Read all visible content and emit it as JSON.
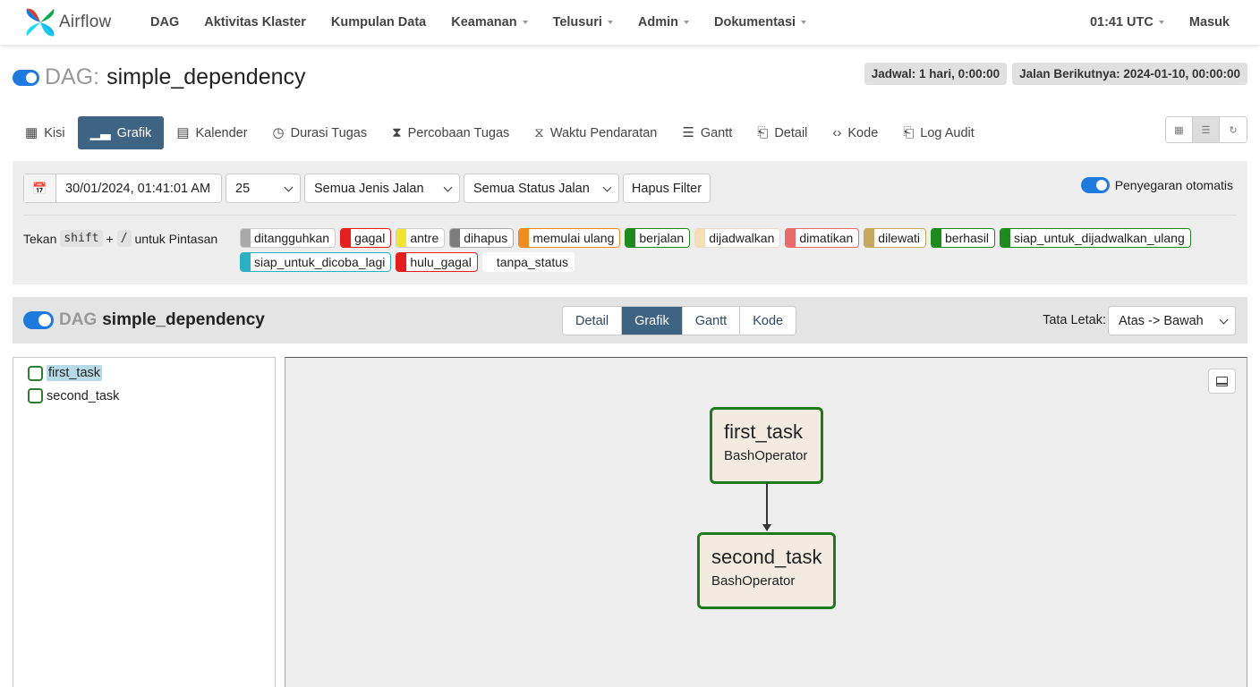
{
  "navbar": {
    "brand": "Airflow",
    "items": [
      {
        "label": "DAG",
        "dropdown": false
      },
      {
        "label": "Aktivitas Klaster",
        "dropdown": false
      },
      {
        "label": "Kumpulan Data",
        "dropdown": false
      },
      {
        "label": "Keamanan",
        "dropdown": true
      },
      {
        "label": "Telusuri",
        "dropdown": true
      },
      {
        "label": "Admin",
        "dropdown": true
      },
      {
        "label": "Dokumentasi",
        "dropdown": true
      }
    ],
    "time": "01:41 UTC",
    "login": "Masuk"
  },
  "dag": {
    "label": "DAG:",
    "name": "simple_dependency",
    "schedule_badge": "Jadwal: 1 hari, 0:00:00",
    "next_run_badge": "Jalan Berikutnya: 2024-01-10, 00:00:00"
  },
  "tabs": [
    {
      "label": "Kisi",
      "icon": "grid-icon"
    },
    {
      "label": "Grafik",
      "icon": "bar-chart-icon",
      "active": true
    },
    {
      "label": "Kalender",
      "icon": "calendar-icon"
    },
    {
      "label": "Durasi Tugas",
      "icon": "clock-icon"
    },
    {
      "label": "Percobaan Tugas",
      "icon": "hourglass-icon"
    },
    {
      "label": "Waktu Pendaratan",
      "icon": "hourglass-outline-icon"
    },
    {
      "label": "Gantt",
      "icon": "gantt-icon"
    },
    {
      "label": "Detail",
      "icon": "document-icon"
    },
    {
      "label": "Kode",
      "icon": "code-icon"
    },
    {
      "label": "Log Audit",
      "icon": "log-icon"
    }
  ],
  "filters": {
    "date": "30/01/2024, 01:41:01 AM",
    "count": "25",
    "run_type": "Semua Jenis Jalan",
    "run_status": "Semua Status Jalan",
    "clear_button": "Hapus Filter",
    "auto_refresh": "Penyegaran otomatis",
    "shortcut_prefix": "Tekan",
    "shortcut_key1": "shift",
    "shortcut_plus": "+",
    "shortcut_key2": "/",
    "shortcut_suffix": "untuk Pintasan"
  },
  "states": [
    {
      "label": "ditangguhkan",
      "color": "#a9a9a9",
      "border": "#cccccc"
    },
    {
      "label": "gagal",
      "color": "#e51d1d",
      "border": "#e51d1d"
    },
    {
      "label": "antre",
      "color": "#f2e52a",
      "border": "#cccccc"
    },
    {
      "label": "dihapus",
      "color": "#7d7d7d",
      "border": "#aaaaaa"
    },
    {
      "label": "memulai ulang",
      "color": "#f28c1d",
      "border": "#f28c1d"
    },
    {
      "label": "berjalan",
      "color": "#1d8a1d",
      "border": "#1d8a1d"
    },
    {
      "label": "dijadwalkan",
      "color": "#f5deb3",
      "border": "#e8dcc4"
    },
    {
      "label": "dimatikan",
      "color": "#e86a6a",
      "border": "#e86a6a"
    },
    {
      "label": "dilewati",
      "color": "#c4a860",
      "border": "#c4a860"
    },
    {
      "label": "berhasil",
      "color": "#1d8a1d",
      "border": "#1d8a1d"
    },
    {
      "label": "siap_untuk_dijadwalkan_ulang",
      "color": "#1d8a1d",
      "border": "#1d8a1d"
    },
    {
      "label": "siap_untuk_dicoba_lagi",
      "color": "#2ab0c4",
      "border": "#2ab0c4"
    },
    {
      "label": "hulu_gagal",
      "color": "#e51d1d",
      "border": "#e51d1d"
    },
    {
      "label": "tanpa_status",
      "color": "#ffffff",
      "border": "#ffffff"
    }
  ],
  "graph_header": {
    "dag_label": "DAG",
    "dag_name": "simple_dependency",
    "views": [
      {
        "label": "Detail"
      },
      {
        "label": "Grafik",
        "active": true
      },
      {
        "label": "Gantt"
      },
      {
        "label": "Kode"
      }
    ],
    "layout_label": "Tata Letak:",
    "layout_value": "Atas -> Bawah"
  },
  "tasks": [
    "first_task",
    "second_task"
  ],
  "nodes": [
    {
      "name": "first_task",
      "operator": "BashOperator"
    },
    {
      "name": "second_task",
      "operator": "BashOperator"
    }
  ],
  "colors": {
    "accent": "#3f6382",
    "toggle": "#1f7ae0",
    "success_border": "#1f7a1f",
    "node_fill": "#f3ebdf"
  }
}
